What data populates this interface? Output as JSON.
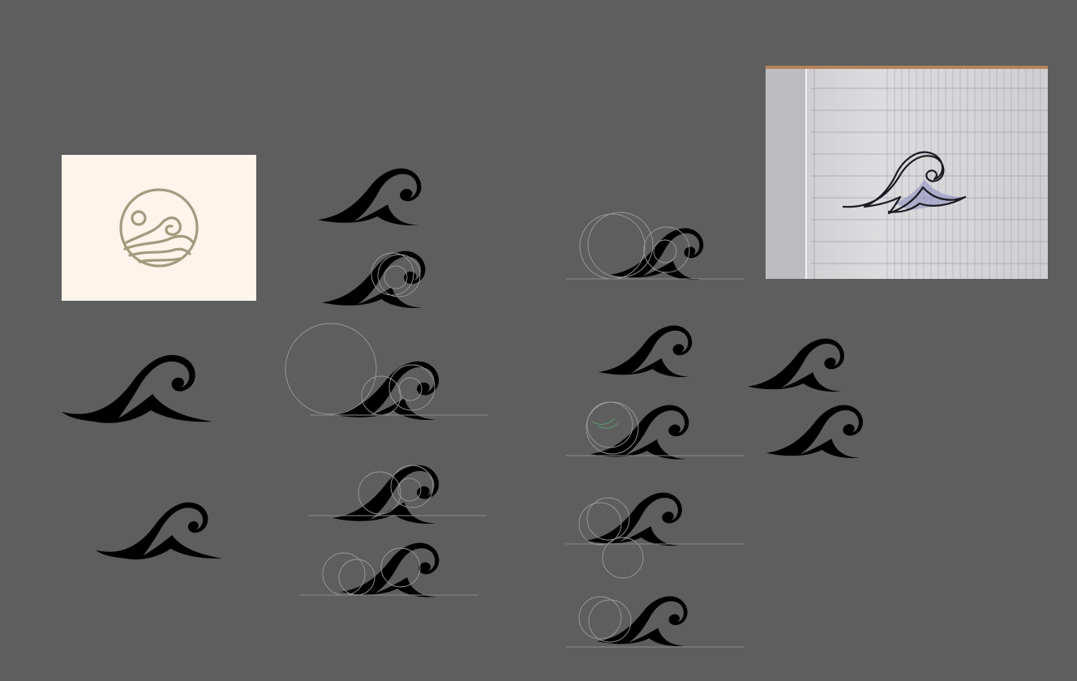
{
  "canvas": {
    "background": "#5e5e5e",
    "wave_color": "#000000",
    "guide_stroke": "#9a9a9a",
    "baseline_stroke": "#8a8a8a"
  },
  "logo_card": {
    "background": "#fdf4ea",
    "emblem_color": "#a39a7f",
    "icon": "circle-sun-wave-logo-icon"
  },
  "sketch_photo": {
    "paper": "#d9d9dc",
    "line_color": "#8a8aa0",
    "margin_color": "#b0a8b0",
    "top_edge": "#b7825a",
    "ink": "#1a1a22",
    "pencil_shade": "#8a8ac0",
    "icon": "hand-drawn-wave-sketch"
  },
  "variants": [
    {
      "name": "wave-variant-plain-1",
      "guides": false
    },
    {
      "name": "wave-variant-guides-2",
      "guides": true
    },
    {
      "name": "wave-variant-large-guide-3",
      "guides": true
    },
    {
      "name": "wave-variant-long-tail-4",
      "guides": false
    },
    {
      "name": "wave-variant-long-tail-5",
      "guides": false
    }
  ]
}
